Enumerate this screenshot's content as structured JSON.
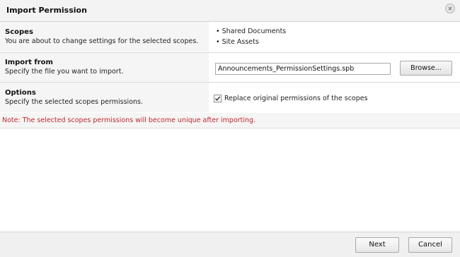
{
  "dialog": {
    "title": "Import Permission",
    "close_icon": "close-circle-icon"
  },
  "scopes": {
    "heading": "Scopes",
    "description": "You are about to change settings for the selected scopes.",
    "items": [
      "Shared Documents",
      "Site Assets"
    ]
  },
  "import_from": {
    "heading": "Import from",
    "description": "Specify the file you want to import.",
    "file_value": "Announcements_PermissionSettings.spb",
    "browse_label": "Browse..."
  },
  "options": {
    "heading": "Options",
    "description": "Specify the selected scopes permissions.",
    "replace_checked": true,
    "replace_label": "Replace original permissions of the scopes"
  },
  "note": {
    "text": "Note: The selected scopes permissions will become unique after importing.",
    "color": "#c0272d"
  },
  "footer": {
    "next_label": "Next",
    "cancel_label": "Cancel"
  }
}
